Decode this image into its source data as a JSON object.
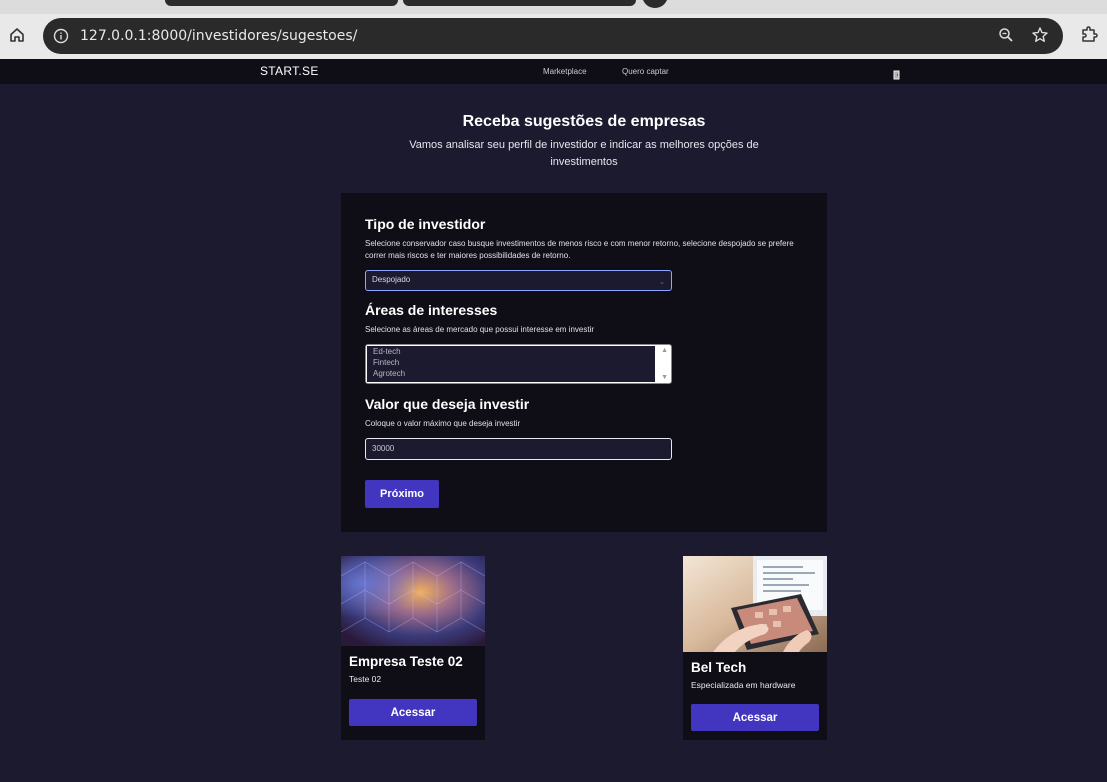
{
  "browser": {
    "url": "127.0.0.1:8000/investidores/sugestoes/"
  },
  "navbar": {
    "brand": "START.SE",
    "links": [
      "Marketplace",
      "Quero captar"
    ]
  },
  "hero": {
    "title": "Receba sugestões de empresas",
    "subtitle": "Vamos analisar seu perfil de investidor e indicar as melhores opções de investimentos"
  },
  "form": {
    "investor_type": {
      "title": "Tipo de investidor",
      "help": "Selecione conservador caso busque investimentos de menos risco e com menor retorno, selecione despojado se prefere correr mais riscos e ter maiores possibilidades de retorno.",
      "selected": "Despojado"
    },
    "areas": {
      "title": "Áreas de interesses",
      "help": "Selecione as áreas de mercado que possui interesse em investir",
      "options": [
        "Ed-tech",
        "Fintech",
        "Agrotech"
      ]
    },
    "amount": {
      "title": "Valor que deseja investir",
      "help": "Coloque o valor máximo que deseja investir",
      "value": "30000"
    },
    "next_label": "Próximo"
  },
  "companies": [
    {
      "name": "Empresa Teste 02",
      "description": "Teste 02",
      "button": "Acessar"
    },
    {
      "name": "Bel Tech",
      "description": "Especializada em hardware",
      "button": "Acessar"
    }
  ],
  "colors": {
    "background": "#1c1a2e",
    "surface": "#0f0e17",
    "accent": "#4235c0"
  }
}
